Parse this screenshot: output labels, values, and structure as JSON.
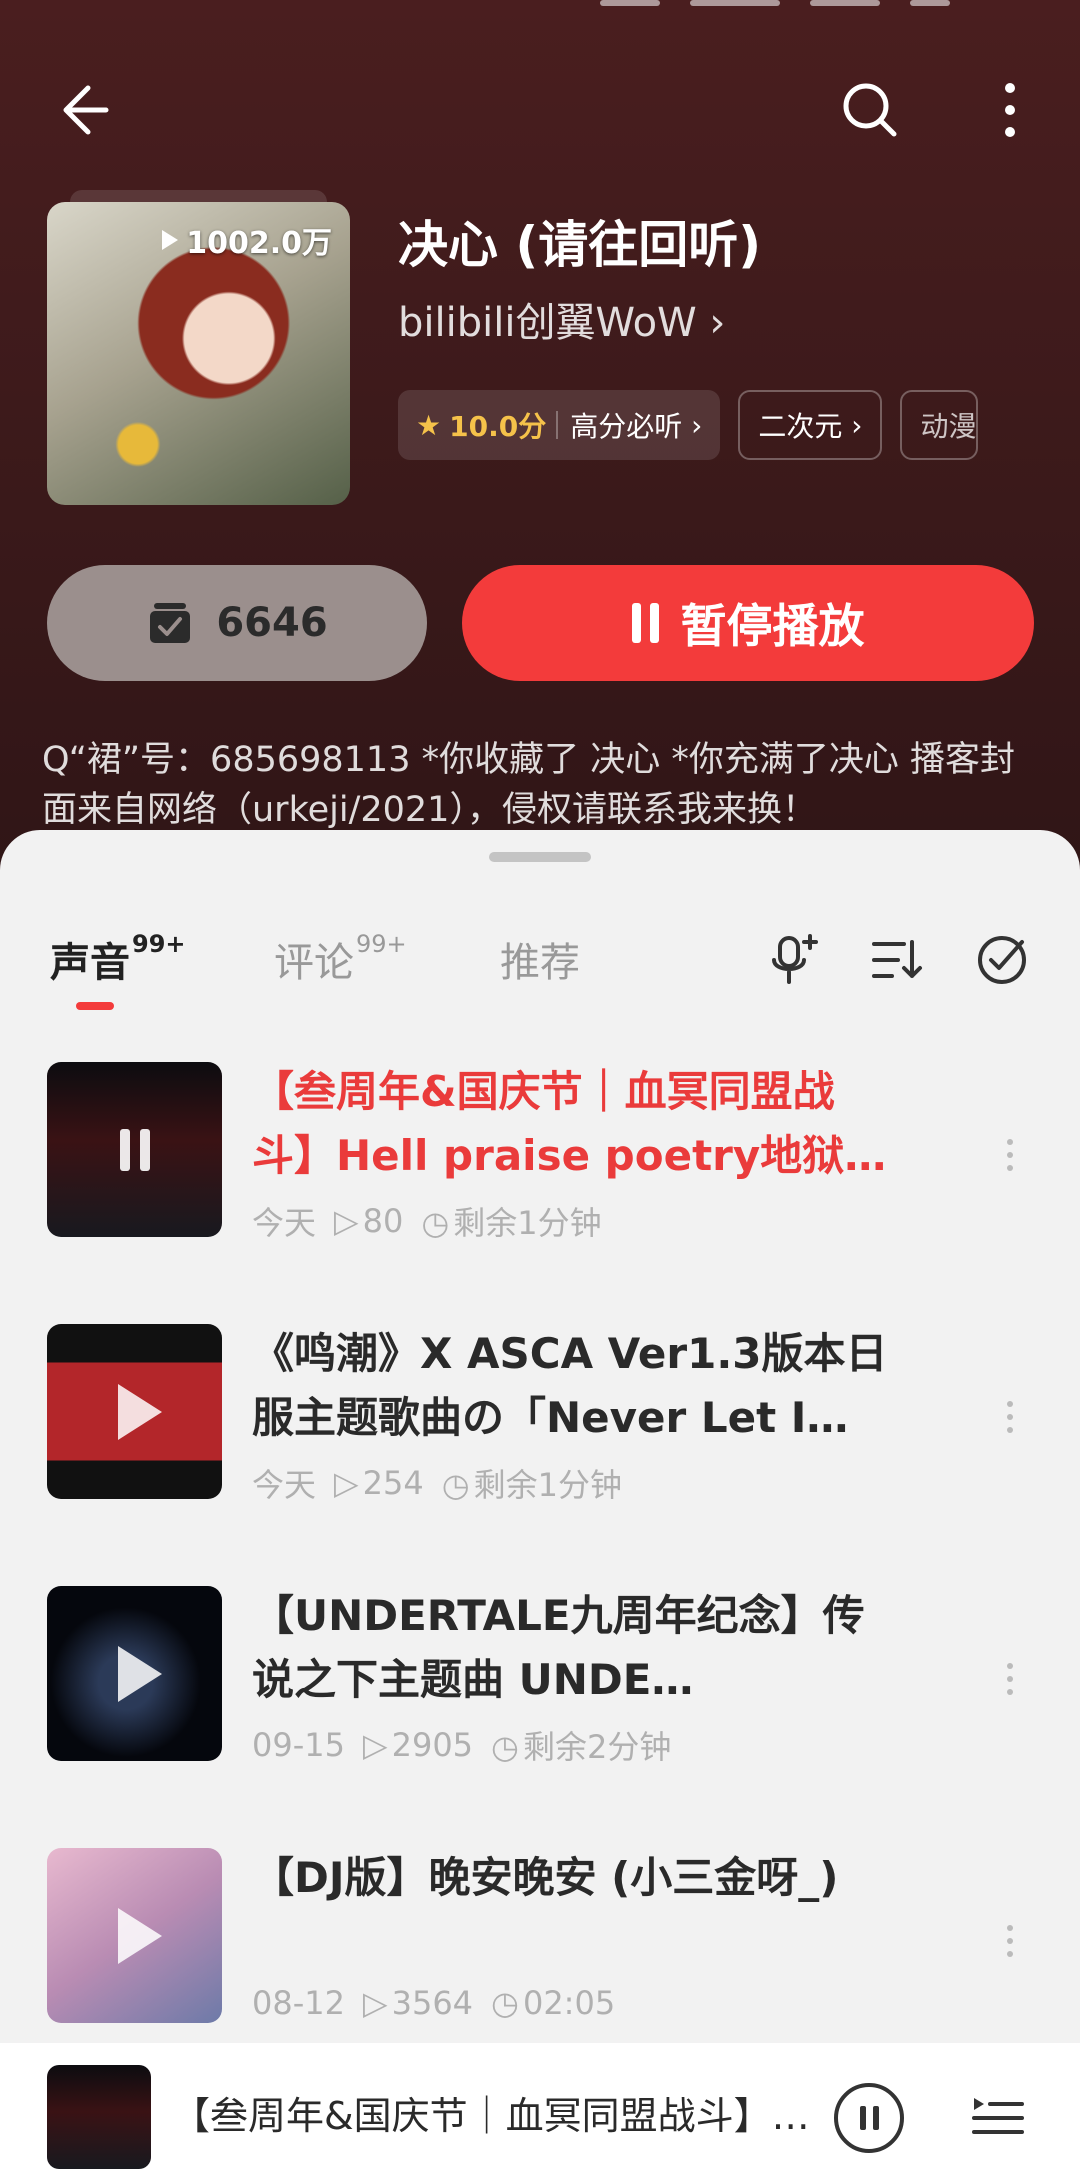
{
  "header": {
    "album_title": "决心 (请往回听)",
    "author": "bilibili创翼WoW",
    "play_count": "1002.0万",
    "tags": {
      "rating_score": "10.0分",
      "rating_label": "高分必听",
      "tag2": "二次元",
      "tag3": "动漫"
    }
  },
  "actions": {
    "subscribe_count": "6646",
    "play_label": "暂停播放"
  },
  "description": "Q“裙”号：685698113 *你收藏了 决心 *你充满了决心 播客封面来自网络（urkeji/2021），侵权请联系我来换！",
  "tabs": [
    {
      "label": "声音",
      "badge": "99+"
    },
    {
      "label": "评论",
      "badge": "99+"
    },
    {
      "label": "推荐",
      "badge": ""
    }
  ],
  "tracks": [
    {
      "title": "【叁周年&国庆节｜血冥同盟战斗】Hell praise poetry地狱…",
      "date": "今天",
      "plays": "80",
      "duration": "剩余1分钟",
      "playing": true
    },
    {
      "title": "《鸣潮》X ASCA Ver1.3版本日服主题歌曲の「Never Let I…",
      "date": "今天",
      "plays": "254",
      "duration": "剩余1分钟",
      "playing": false
    },
    {
      "title": "【UNDERTALE九周年纪念】传说之下主题曲 UNDE…",
      "date": "09-15",
      "plays": "2905",
      "duration": "剩余2分钟",
      "playing": false
    },
    {
      "title": "【DJ版】晚安晚安 (小三金呀_)",
      "date": "08-12",
      "plays": "3564",
      "duration": "02:05",
      "playing": false
    }
  ],
  "mini_player": {
    "title": "【叁周年&国庆节｜血冥同盟战斗】Hell praise poetry地狱"
  },
  "colors": {
    "accent": "#f33b3b",
    "rating": "#f5c24a",
    "header_bg": "#3d1a1b"
  }
}
